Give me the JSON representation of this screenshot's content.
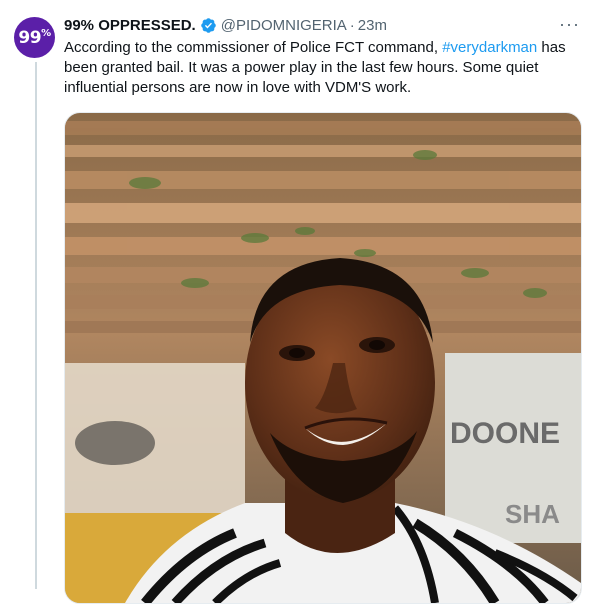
{
  "tweet": {
    "avatar_text": "99",
    "avatar_sup": "%",
    "display_name": "99% OPPRESSED.",
    "handle": "@PIDOMNIGERIA",
    "separator": "·",
    "time": "23m",
    "more": "···",
    "text_before": "According to the commissioner of Police FCT command, ",
    "hashtag": "#verydarkman",
    "text_after": " has been granted bail. It was a power play in the last few hours. Some quiet influential persons are now in love with VDM'S work.",
    "media_sign_text": "DOONE",
    "media_sign_text2": "SHA"
  },
  "colors": {
    "accent": "#1d9bf0",
    "avatar_bg": "#5b1fa8",
    "muted": "#536471"
  },
  "icons": {
    "verified": "verified-badge-icon",
    "more": "more-options-icon"
  }
}
